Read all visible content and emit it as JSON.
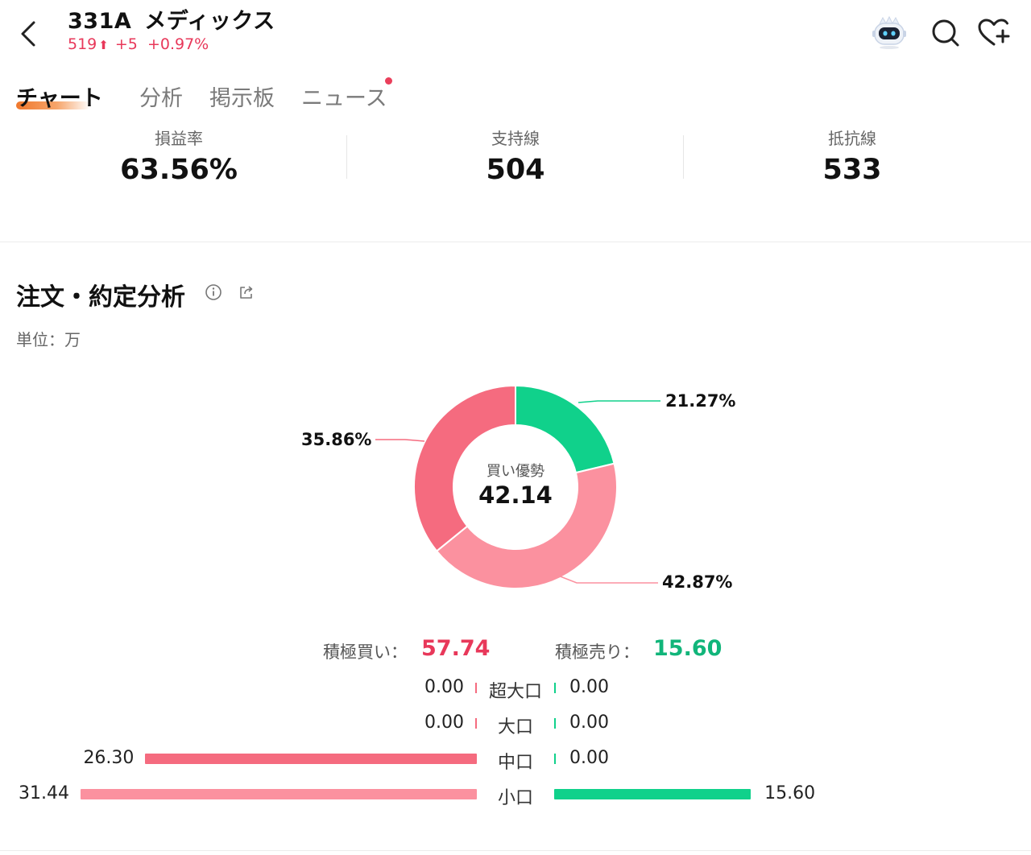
{
  "header": {
    "ticker": "331A",
    "name": "メディックス",
    "price": "519",
    "change": "+5",
    "change_pct": "+0.97%",
    "up_color": "#e8385a",
    "icons": [
      "back-chevron-icon",
      "robot-assistant-icon",
      "search-icon",
      "favorite-add-icon"
    ]
  },
  "tabs": [
    {
      "label": "チャート",
      "active": true
    },
    {
      "label": "分析",
      "active": false
    },
    {
      "label": "掲示板",
      "active": false
    },
    {
      "label": "ニュース",
      "active": false,
      "badge_dot": true
    }
  ],
  "stats": [
    {
      "label": "損益率",
      "value": "63.56%"
    },
    {
      "label": "支持線",
      "value": "504"
    },
    {
      "label": "抵抗線",
      "value": "533"
    }
  ],
  "section": {
    "title": "注文・約定分析",
    "unit": "単位：万",
    "icons": [
      "info-icon",
      "share-icon"
    ]
  },
  "chart_data": {
    "type": "pie",
    "style": "donut",
    "center_label": "買い優勢",
    "center_value": "42.14",
    "slices": [
      {
        "label": "21.27%",
        "value": 21.27,
        "color": "#10d18b"
      },
      {
        "label": "42.87%",
        "value": 42.87,
        "color": "#fb919f"
      },
      {
        "label": "35.86%",
        "value": 35.86,
        "color": "#f56b7f"
      }
    ]
  },
  "summary": {
    "buy_label": "積極買い：",
    "buy_value": "57.74",
    "sell_label": "積極売り：",
    "sell_value": "15.60",
    "buy_color": "#e8385a",
    "sell_color": "#11b57a"
  },
  "breakdown": {
    "max": 31.44,
    "rows": [
      {
        "label": "超大口",
        "buy": "0.00",
        "buy_value": 0,
        "sell": "0.00",
        "sell_value": 0,
        "buy_color": "#f56b7f"
      },
      {
        "label": "大口",
        "buy": "0.00",
        "buy_value": 0,
        "sell": "0.00",
        "sell_value": 0,
        "buy_color": "#f56b7f"
      },
      {
        "label": "中口",
        "buy": "26.30",
        "buy_value": 26.3,
        "sell": "0.00",
        "sell_value": 0,
        "buy_color": "#f56b7f"
      },
      {
        "label": "小口",
        "buy": "31.44",
        "buy_value": 31.44,
        "sell": "15.60",
        "sell_value": 15.6,
        "buy_color": "#fb919f"
      }
    ],
    "sell_color": "#10d18b"
  }
}
